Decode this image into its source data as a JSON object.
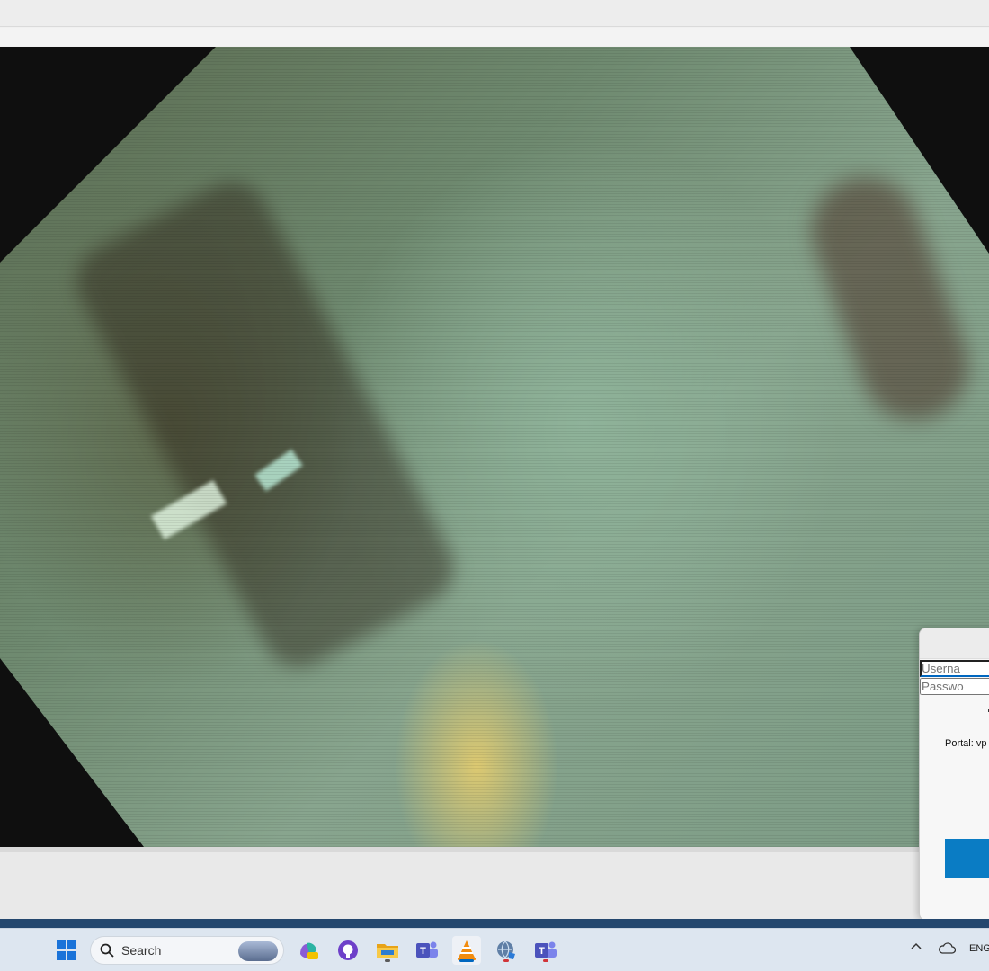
{
  "dialog": {
    "portal_label": "Portal: vp",
    "username_placeholder": "Userna",
    "password_placeholder": "Passwo"
  },
  "taskbar": {
    "search_label": "Search",
    "language": "ENG",
    "apps": [
      {
        "icon": "copilot-icon",
        "state": "idle"
      },
      {
        "icon": "github-icon",
        "state": "idle"
      },
      {
        "icon": "file-explorer-icon",
        "state": "running"
      },
      {
        "icon": "teams-icon",
        "state": "idle"
      },
      {
        "icon": "vlc-icon",
        "state": "active"
      },
      {
        "icon": "vpn-globe-icon",
        "state": "alert"
      },
      {
        "icon": "teams-work-icon",
        "state": "alert"
      }
    ]
  },
  "colors": {
    "accent": "#0067c0",
    "connect_button": "#0a7cc4",
    "alert_dot": "#d13438"
  }
}
